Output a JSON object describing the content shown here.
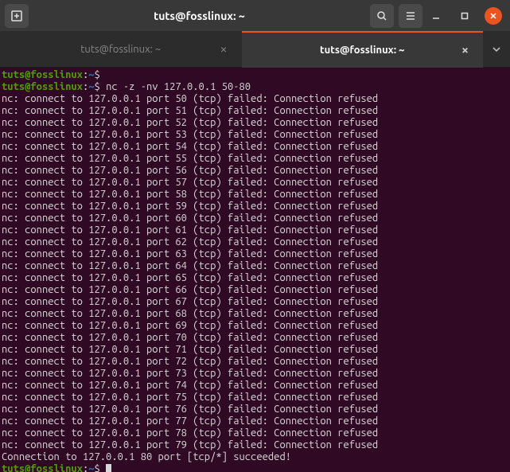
{
  "window": {
    "title": "tuts@fosslinux: ~"
  },
  "tabs": {
    "inactive": {
      "label": "tuts@fosslinux: ~"
    },
    "active": {
      "label": "tuts@fosslinux: ~"
    }
  },
  "prompt": {
    "user": "tuts",
    "at": "@",
    "host": "fosslinux",
    "colon": ":",
    "path": "~",
    "dollar": "$"
  },
  "command": "nc -z -nv 127.0.0.1 50-80",
  "output_template": {
    "prefix": "nc: connect to 127.0.0.1 port ",
    "suffix": " (tcp) failed: Connection refused"
  },
  "failed_ports": [
    50,
    51,
    52,
    53,
    54,
    55,
    56,
    57,
    58,
    59,
    60,
    61,
    62,
    63,
    64,
    65,
    66,
    67,
    68,
    69,
    70,
    71,
    72,
    73,
    74,
    75,
    76,
    77,
    78,
    79
  ],
  "success_line": "Connection to 127.0.0.1 80 port [tcp/*] succeeded!"
}
